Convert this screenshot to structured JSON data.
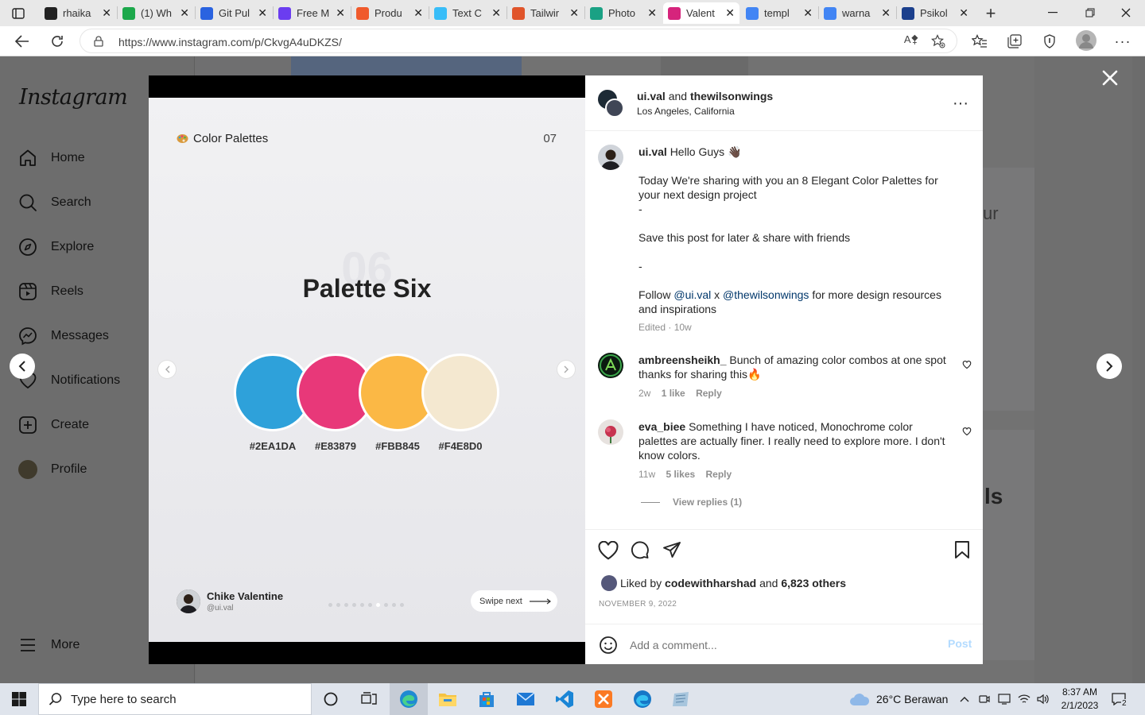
{
  "browser": {
    "tabs": [
      {
        "title": "rhaika",
        "icon": "github-icon",
        "color": "#222222"
      },
      {
        "title": "(1) Wh",
        "icon": "whatsapp-badge-icon",
        "color": "#1ca84b"
      },
      {
        "title": "Git Pul",
        "icon": "atlassian-icon",
        "color": "#2a63e0"
      },
      {
        "title": "Free M",
        "icon": "typedream-icon",
        "color": "#6b3df0"
      },
      {
        "title": "Produ",
        "icon": "shop-icon",
        "color": "#f05a2c"
      },
      {
        "title": "Text C",
        "icon": "tailwind-icon",
        "color": "#38bdf8"
      },
      {
        "title": "Tailwir",
        "icon": "grid-icon",
        "color": "#e0552b"
      },
      {
        "title": "Photo",
        "icon": "photopea-icon",
        "color": "#1aa184"
      },
      {
        "title": "Valent",
        "icon": "instagram-icon",
        "color": "#d6247c"
      },
      {
        "title": "templ",
        "icon": "google-icon",
        "color": "#4285f4"
      },
      {
        "title": "warna",
        "icon": "google-icon",
        "color": "#4285f4"
      },
      {
        "title": "Psikol",
        "icon": "e-icon",
        "color": "#1b3f8c"
      }
    ],
    "url": "https://www.instagram.com/p/CkvgA4uDKZS/"
  },
  "sidebar": {
    "logo": "Instagram",
    "items": [
      {
        "label": "Home",
        "icon": "home-icon"
      },
      {
        "label": "Search",
        "icon": "search-icon"
      },
      {
        "label": "Explore",
        "icon": "compass-icon"
      },
      {
        "label": "Reels",
        "icon": "reels-icon"
      },
      {
        "label": "Messages",
        "icon": "messenger-icon"
      },
      {
        "label": "Notifications",
        "icon": "heart-icon"
      },
      {
        "label": "Create",
        "icon": "plus-square-icon"
      },
      {
        "label": "Profile",
        "icon": "avatar"
      },
      {
        "label": "More",
        "icon": "menu-icon"
      }
    ]
  },
  "background": {
    "partial_text_1": "ur",
    "partial_text_2": "ls"
  },
  "slide": {
    "brand": "Color Palettes",
    "number": "07",
    "big_number": "06",
    "title": "Palette Six",
    "swatches": [
      {
        "hex": "#2EA1DA",
        "label": "#2EA1DA"
      },
      {
        "hex": "#E83879",
        "label": "#E83879"
      },
      {
        "hex": "#FBB845",
        "label": "#FBB845"
      },
      {
        "hex": "#F4E8D0",
        "label": "#F4E8D0"
      }
    ],
    "author_name": "Chike Valentine",
    "author_handle": "@ui.val",
    "swipe_label": "Swipe next",
    "dot_count": 10,
    "active_dot": 6
  },
  "post": {
    "user1": "ui.val",
    "and": "and",
    "user2": "thewilsonwings",
    "location": "Los Angeles, California",
    "caption": {
      "username": "ui.val",
      "greeting": "Hello Guys 👋🏿",
      "line1": "Today We're sharing with you an 8 Elegant Color Palettes for your next design project",
      "dash1": "-",
      "line2": "Save this post for later & share with friends",
      "dash2": "-",
      "follow_pre": "Follow",
      "mention1": "@ui.val",
      "x": "x",
      "mention2": "@thewilsonwings",
      "follow_post": "for more design resources and inspirations",
      "meta": "Edited · 10w"
    },
    "comments": [
      {
        "username": "ambreensheikh_",
        "text": "Bunch of amazing color combos at one spot thanks for sharing this🔥",
        "age": "2w",
        "likes": "1 like",
        "reply": "Reply"
      },
      {
        "username": "eva_biee",
        "text": "Something I have noticed, Monochrome color palettes are actually finer. I really need to explore more. I don't know colors.",
        "age": "11w",
        "likes": "5 likes",
        "reply": "Reply",
        "view_replies": "View replies (1)"
      }
    ],
    "liked_by_pre": "Liked by",
    "liked_by_user": "codewithharshad",
    "liked_by_and": "and",
    "liked_by_others": "6,823 others",
    "date": "NOVEMBER 9, 2022",
    "comment_placeholder": "Add a comment...",
    "post_button": "Post"
  },
  "taskbar": {
    "search_placeholder": "Type here to search",
    "weather": "26°C  Berawan",
    "time": "8:37 AM",
    "date": "2/1/2023",
    "notification_count": "2"
  }
}
